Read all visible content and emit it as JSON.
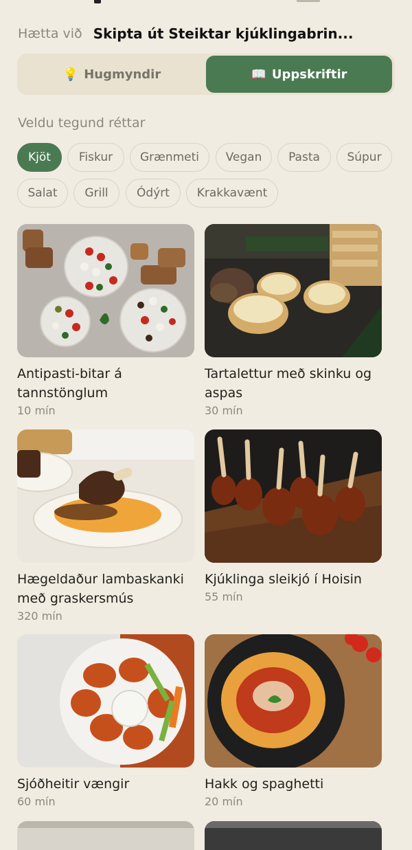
{
  "header": {
    "cancel_label": "Hætta við",
    "title": "Skipta út Steiktar kjúklingabrin..."
  },
  "mode_toggle": {
    "options": [
      {
        "icon": "lightbulb-icon",
        "glyph": "💡",
        "label": "Hugmyndir",
        "selected": false
      },
      {
        "icon": "book-icon",
        "glyph": "📖",
        "label": "Uppskriftir",
        "selected": true
      }
    ]
  },
  "filters": {
    "heading": "Veldu tegund réttar",
    "chips": [
      {
        "label": "Kjöt",
        "selected": true
      },
      {
        "label": "Fiskur",
        "selected": false
      },
      {
        "label": "Grænmeti",
        "selected": false
      },
      {
        "label": "Vegan",
        "selected": false
      },
      {
        "label": "Pasta",
        "selected": false
      },
      {
        "label": "Súpur",
        "selected": false
      },
      {
        "label": "Salat",
        "selected": false
      },
      {
        "label": "Grill",
        "selected": false
      },
      {
        "label": "Ódýrt",
        "selected": false
      },
      {
        "label": "Krakkavænt",
        "selected": false
      }
    ]
  },
  "recipes": [
    {
      "name_line1": "Antipasti-bitar á",
      "name_line2": "tannstönglum",
      "time": "10 mín"
    },
    {
      "name_line1": "Tartalettur með skinku og",
      "name_line2": "aspas",
      "time": "30 mín"
    },
    {
      "name_line1": "Hægeldaður lambaskanki",
      "name_line2": "með graskersmús",
      "time": "320 mín"
    },
    {
      "name_line1": "Kjúklinga sleikjó í Hoisin",
      "name_line2": "",
      "time": "55 mín"
    },
    {
      "name_line1": "Sjóðheitir vængir",
      "name_line2": "",
      "time": "60 mín"
    },
    {
      "name_line1": "Hakk og spaghetti",
      "name_line2": "",
      "time": "20 mín"
    }
  ],
  "colors": {
    "background": "#f1ece1",
    "accent_green": "#4a7a51",
    "muted_text": "#8c887f"
  }
}
